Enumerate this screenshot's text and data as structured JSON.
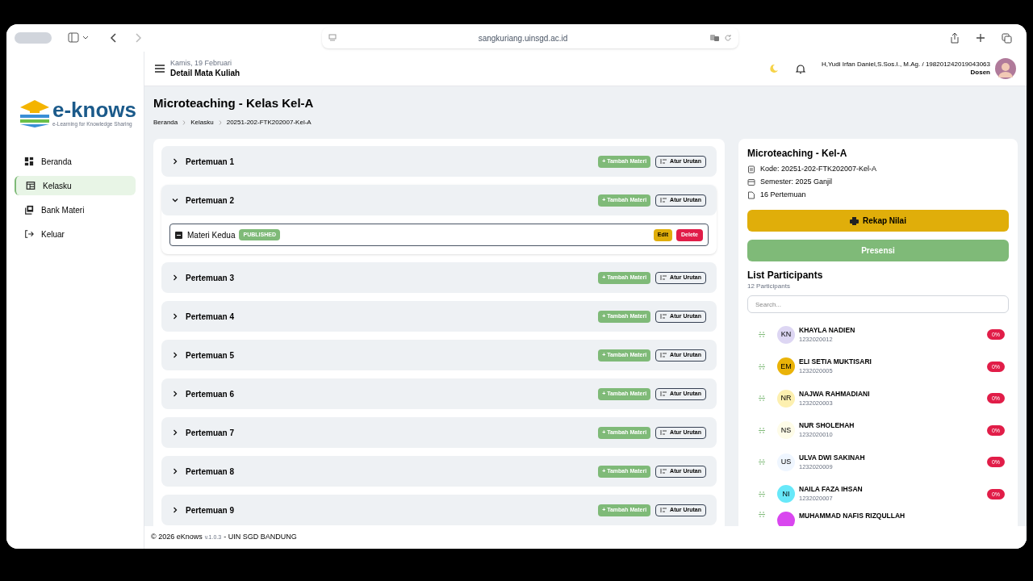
{
  "browser": {
    "url": "sangkuriang.uinsgd.ac.id"
  },
  "sidebar": {
    "logo": "e-knows",
    "tagline": "e-Learning for Knowledge Sharing",
    "items": [
      {
        "label": "Beranda",
        "selected": false
      },
      {
        "label": "Kelasku",
        "selected": true
      },
      {
        "label": "Bank Materi",
        "selected": false
      },
      {
        "label": "Keluar",
        "selected": false
      }
    ]
  },
  "header": {
    "date": "Kamis, 19 Februari",
    "title": "Detail Mata Kuliah",
    "user": "H,Yudi Irfan Daniel,S.Sos.I., M.Ag. / 198201242019043063",
    "role": "Dosen"
  },
  "page": {
    "title": "Microteaching - Kelas Kel-A",
    "breadcrumb": [
      "Beranda",
      "Kelasku",
      "20251-202-FTK202007-Kel-A"
    ]
  },
  "meetings": [
    {
      "title": "Pertemuan 1",
      "expanded": false,
      "add": "+ Tambah Materi",
      "order": "Atur Urutan"
    },
    {
      "title": "Pertemuan 2",
      "expanded": true,
      "add": "+ Tambah Materi",
      "order": "Atur Urutan",
      "materials": [
        {
          "title": "Materi Kedua",
          "status": "PUBLISHED",
          "edit": "Edit",
          "delete": "Delete"
        }
      ]
    },
    {
      "title": "Pertemuan 3",
      "expanded": false,
      "add": "+ Tambah Materi",
      "order": "Atur Urutan"
    },
    {
      "title": "Pertemuan 4",
      "expanded": false,
      "add": "+ Tambah Materi",
      "order": "Atur Urutan"
    },
    {
      "title": "Pertemuan 5",
      "expanded": false,
      "add": "+ Tambah Materi",
      "order": "Atur Urutan"
    },
    {
      "title": "Pertemuan 6",
      "expanded": false,
      "add": "+ Tambah Materi",
      "order": "Atur Urutan"
    },
    {
      "title": "Pertemuan 7",
      "expanded": false,
      "add": "+ Tambah Materi",
      "order": "Atur Urutan"
    },
    {
      "title": "Pertemuan 8",
      "expanded": false,
      "add": "+ Tambah Materi",
      "order": "Atur Urutan"
    },
    {
      "title": "Pertemuan 9",
      "expanded": false,
      "add": "+ Tambah Materi",
      "order": "Atur Urutan"
    }
  ],
  "course": {
    "title": "Microteaching - Kel-A",
    "info": [
      {
        "kind": "code",
        "text": "Kode: 20251-202-FTK202007-Kel-A"
      },
      {
        "kind": "semester",
        "text": "Semester: 2025 Ganjil"
      },
      {
        "kind": "meetings",
        "text": "16 Pertemuan"
      }
    ],
    "recap": "Rekap Nilai",
    "attendance": "Presensi"
  },
  "participants": {
    "title": "List Participants",
    "count": "12 Participants",
    "search": {
      "placeholder": "Search..."
    },
    "items": [
      {
        "initials": "KN",
        "name": "KHAYLA NADIEN",
        "nim": "1232020012",
        "percent": "0%",
        "color": "#ddd6f3"
      },
      {
        "initials": "EM",
        "name": "ELI SETIA MUKTISARI",
        "nim": "1232020005",
        "percent": "0%",
        "color": "#eab308"
      },
      {
        "initials": "NR",
        "name": "NAJWA RAHMADIANI",
        "nim": "1232020003",
        "percent": "0%",
        "color": "#fdf0b0"
      },
      {
        "initials": "NS",
        "name": "NUR SHOLEHAH",
        "nim": "1232020010",
        "percent": "0%",
        "color": "#fefce8"
      },
      {
        "initials": "US",
        "name": "ULVA DWI SAKINAH",
        "nim": "1232020009",
        "percent": "0%",
        "color": "#eff6ff"
      },
      {
        "initials": "NI",
        "name": "NAILA FAZA IHSAN",
        "nim": "1232020007",
        "percent": "0%",
        "color": "#67e8f9"
      },
      {
        "name": "MUHAMMAD NAFIS RIZQULLAH",
        "color": "#d946ef"
      }
    ]
  },
  "footer": {
    "copyright": "© 2026 eKnows",
    "version": "v.1.0.3",
    "org": "- UIN SGD BANDUNG"
  }
}
